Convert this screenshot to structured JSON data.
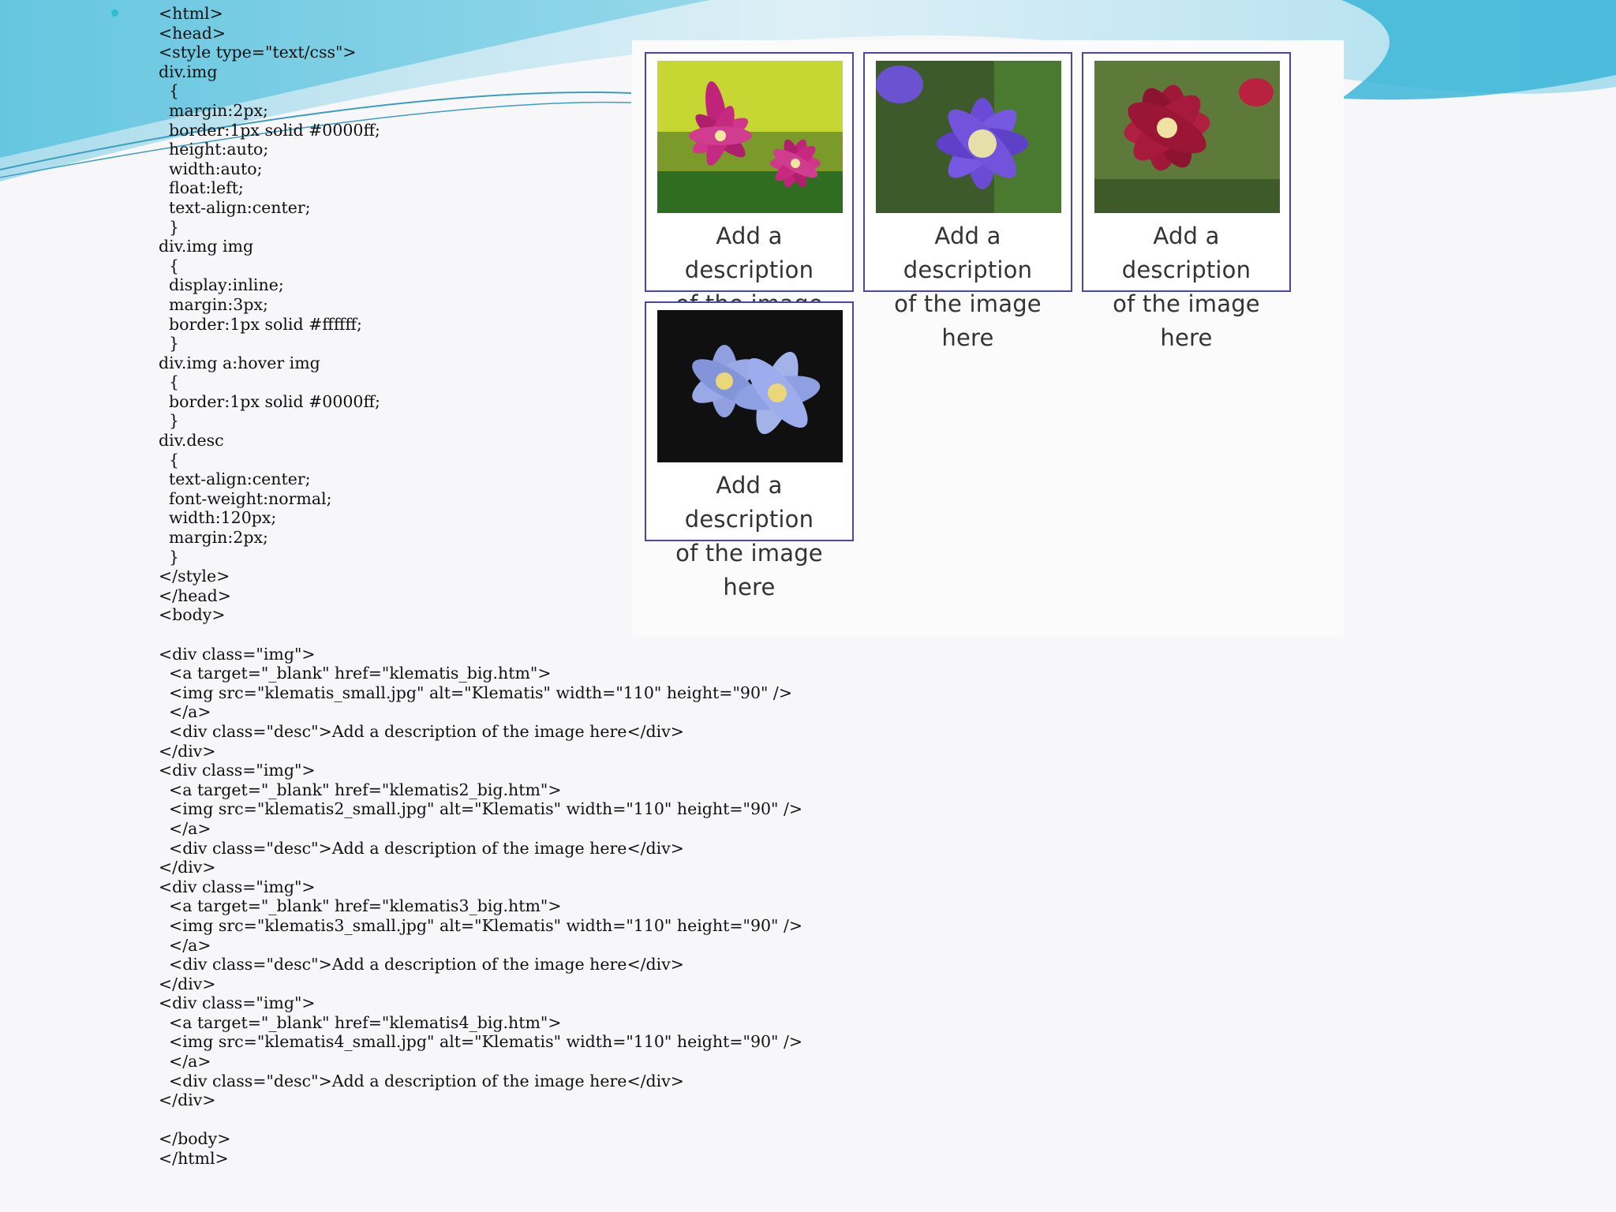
{
  "code_lines": [
    "<html>",
    "<head>",
    "<style type=\"text/css\">",
    "div.img",
    "  {",
    "  margin:2px;",
    "  border:1px solid #0000ff;",
    "  height:auto;",
    "  width:auto;",
    "  float:left;",
    "  text-align:center;",
    "  }",
    "div.img img",
    "  {",
    "  display:inline;",
    "  margin:3px;",
    "  border:1px solid #ffffff;",
    "  }",
    "div.img a:hover img",
    "  {",
    "  border:1px solid #0000ff;",
    "  }",
    "div.desc",
    "  {",
    "  text-align:center;",
    "  font-weight:normal;",
    "  width:120px;",
    "  margin:2px;",
    "  }",
    "</style>",
    "</head>",
    "<body>",
    "",
    "<div class=\"img\">",
    "  <a target=\"_blank\" href=\"klematis_big.htm\">",
    "  <img src=\"klematis_small.jpg\" alt=\"Klematis\" width=\"110\" height=\"90\" />",
    "  </a>",
    "  <div class=\"desc\">Add a description of the image here</div>",
    "</div>",
    "<div class=\"img\">",
    "  <a target=\"_blank\" href=\"klematis2_big.htm\">",
    "  <img src=\"klematis2_small.jpg\" alt=\"Klematis\" width=\"110\" height=\"90\" />",
    "  </a>",
    "  <div class=\"desc\">Add a description of the image here</div>",
    "</div>",
    "<div class=\"img\">",
    "  <a target=\"_blank\" href=\"klematis3_big.htm\">",
    "  <img src=\"klematis3_small.jpg\" alt=\"Klematis\" width=\"110\" height=\"90\" />",
    "  </a>",
    "  <div class=\"desc\">Add a description of the image here</div>",
    "</div>",
    "<div class=\"img\">",
    "  <a target=\"_blank\" href=\"klematis4_big.htm\">",
    "  <img src=\"klematis4_small.jpg\" alt=\"Klematis\" width=\"110\" height=\"90\" />",
    "  </a>",
    "  <div class=\"desc\">Add a description of the image here</div>",
    "</div>",
    "",
    "</body>",
    "</html>"
  ],
  "preview": {
    "tiles": [
      {
        "desc_line1": "Add a description",
        "desc_line2": "of the image here"
      },
      {
        "desc_line1": "Add a description",
        "desc_line2": "of the image here"
      },
      {
        "desc_line1": "Add a description",
        "desc_line2": "of the image here"
      },
      {
        "desc_line1": "Add a description",
        "desc_line2": "of the image here"
      }
    ]
  },
  "colors": {
    "tile_border": "#4a46a8",
    "bullet": "#2bbfd6",
    "wave_light": "#bfe6f2",
    "wave_dark": "#5fc3e0",
    "flower1": "#c0247a",
    "flower2": "#6b4bd6",
    "flower3": "#a01838",
    "flower4": "#8f9fe0"
  }
}
